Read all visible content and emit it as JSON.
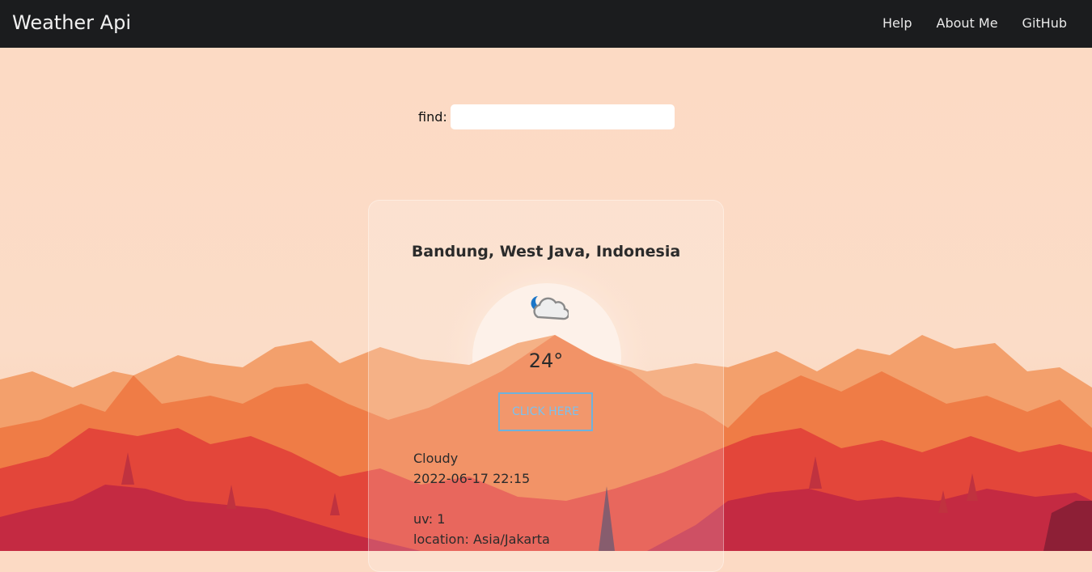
{
  "navbar": {
    "brand": "Weather Api",
    "links": [
      "Help",
      "About Me",
      "GitHub"
    ]
  },
  "search": {
    "label": "find:",
    "value": "",
    "placeholder": ""
  },
  "card": {
    "location": "Bandung, West Java, Indonesia",
    "icon": "partly-cloudy-night-icon",
    "temperature": "24°",
    "button_label": "CLICK HERE",
    "condition": "Cloudy",
    "datetime": "2022-06-17 22:15",
    "uv": "uv: 1",
    "timezone": "location: Asia/Jakarta"
  },
  "colors": {
    "navbar_bg": "#1b1c1e",
    "sky": "#fcdac4",
    "button_border": "#6fb2dc"
  }
}
